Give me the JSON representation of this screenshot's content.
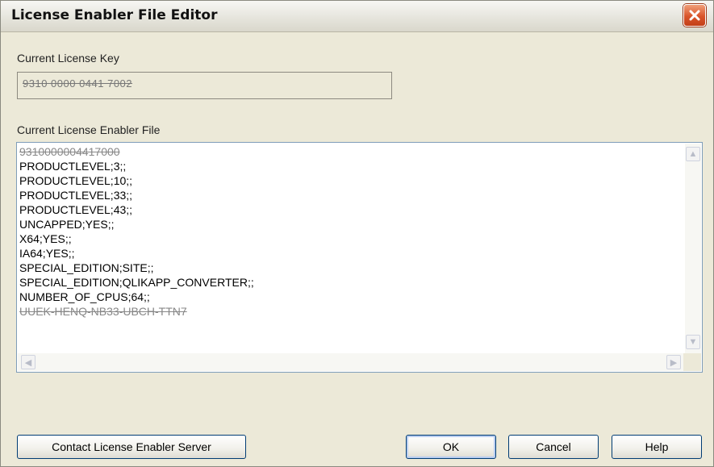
{
  "window": {
    "title": "License Enabler File Editor"
  },
  "license_key": {
    "label": "Current License Key",
    "value": "9310 0000 0441 7002"
  },
  "lef": {
    "label": "Current License Enabler File",
    "first_line": "9310000004417000",
    "lines": [
      "PRODUCTLEVEL;3;;",
      "PRODUCTLEVEL;10;;",
      "PRODUCTLEVEL;33;;",
      "PRODUCTLEVEL;43;;",
      "UNCAPPED;YES;;",
      "X64;YES;;",
      "IA64;YES;;",
      "SPECIAL_EDITION;SITE;;",
      "SPECIAL_EDITION;QLIKAPP_CONVERTER;;",
      "NUMBER_OF_CPUS;64;;"
    ],
    "last_line": "UUEK-HENQ-NB33-UBCH-TTN7"
  },
  "buttons": {
    "contact": "Contact License Enabler Server",
    "ok": "OK",
    "cancel": "Cancel",
    "help": "Help"
  }
}
